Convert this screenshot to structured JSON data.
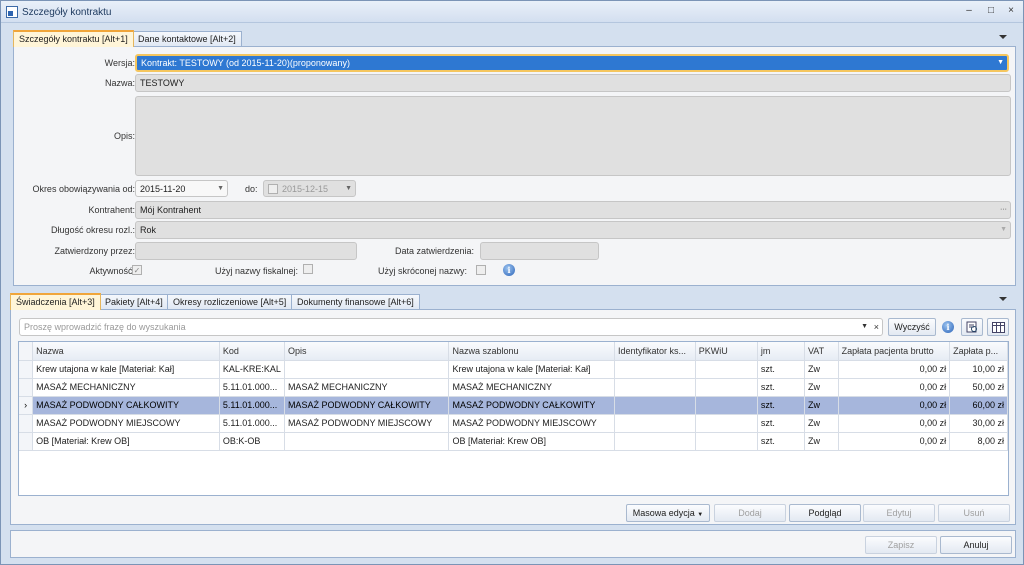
{
  "window": {
    "title": "Szczegóły kontraktu",
    "min": "–",
    "max": "□",
    "close": "×"
  },
  "top_tabs": [
    {
      "label": "Szczegóły kontraktu [Alt+1]"
    },
    {
      "label": "Dane kontaktowe [Alt+2]"
    }
  ],
  "form": {
    "wersja_label": "Wersja:",
    "wersja_value": "Kontrakt: TESTOWY (od 2015-11-20)(proponowany)",
    "nazwa_label": "Nazwa:",
    "nazwa_value": "TESTOWY",
    "opis_label": "Opis:",
    "okres_label": "Okres obowiązywania od:",
    "okres_od": "2015-11-20",
    "do_label": "do:",
    "okres_do": "2015-12-15",
    "kontrahent_label": "Kontrahent:",
    "kontrahent_value": "Mój Kontrahent",
    "dlugosc_label": "Długość okresu rozl.:",
    "dlugosc_value": "Rok",
    "zatwierdzony_label": "Zatwierdzony przez:",
    "zatwierdzony_value": "",
    "data_zatw_label": "Data zatwierdzenia:",
    "data_zatw_value": "",
    "aktywnosc_label": "Aktywność:",
    "fiskalnej_label": "Użyj nazwy fiskalnej:",
    "skroconej_label": "Użyj skróconej nazwy:",
    "ellipsis": "···"
  },
  "bottom_tabs": [
    {
      "label": "Świadczenia [Alt+3]"
    },
    {
      "label": "Pakiety [Alt+4]"
    },
    {
      "label": "Okresy rozliczeniowe [Alt+5]"
    },
    {
      "label": "Dokumenty finansowe [Alt+6]"
    }
  ],
  "search": {
    "placeholder": "Proszę wprowadzić frazę do wyszukania",
    "clear_label": "Wyczyść"
  },
  "table": {
    "columns": [
      "Nazwa",
      "Kod",
      "Opis",
      "Nazwa szablonu",
      "Identyfikator ks...",
      "PKWiU",
      "jm",
      "VAT",
      "Zapłata pacjenta brutto",
      "Zapłata p..."
    ],
    "rows": [
      [
        "Krew utajona w kale [Materiał: Kał]",
        "KAL-KRE:KAL",
        "",
        "Krew utajona w kale [Materiał: Kał]",
        "",
        "",
        "szt.",
        "Zw",
        "0,00 zł",
        "10,00 zł"
      ],
      [
        "MASAŻ MECHANICZNY",
        "5.11.01.000...",
        "MASAŻ MECHANICZNY",
        "MASAŻ MECHANICZNY",
        "",
        "",
        "szt.",
        "Zw",
        "0,00 zł",
        "50,00 zł"
      ],
      [
        "MASAŻ PODWODNY CAŁKOWITY",
        "5.11.01.000...",
        "MASAŻ PODWODNY CAŁKOWITY",
        "MASAŻ PODWODNY CAŁKOWITY",
        "",
        "",
        "szt.",
        "Zw",
        "0,00 zł",
        "60,00 zł"
      ],
      [
        "MASAŻ PODWODNY MIEJSCOWY",
        "5.11.01.000...",
        "MASAŻ PODWODNY MIEJSCOWY",
        "MASAŻ PODWODNY MIEJSCOWY",
        "",
        "",
        "szt.",
        "Zw",
        "0,00 zł",
        "30,00 zł"
      ],
      [
        "OB [Materiał: Krew OB]",
        "OB:K-OB",
        "",
        "OB [Materiał: Krew OB]",
        "",
        "",
        "szt.",
        "Zw",
        "0,00 zł",
        "8,00 zł"
      ]
    ],
    "selected_row": 2,
    "row_marker": "›"
  },
  "actions": {
    "masowa": "Masowa edycja",
    "dodaj": "Dodaj",
    "podglad": "Podgląd",
    "edytuj": "Edytuj",
    "usun": "Usuń"
  },
  "footer": {
    "zapisz": "Zapisz",
    "anuluj": "Anuluj"
  },
  "colors": {
    "selection": "#a6b6dc",
    "active_tab": "#f0a53a",
    "window_bg": "#d4e0ef"
  }
}
